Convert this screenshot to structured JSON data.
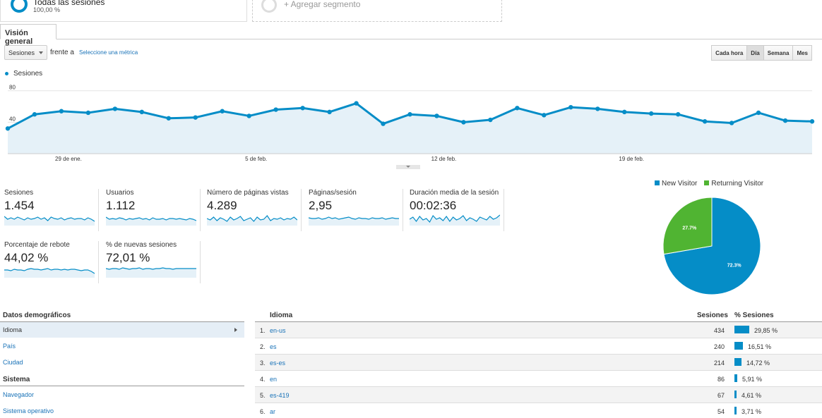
{
  "segments": {
    "active_name": "Todas las sesiones",
    "active_pct": "100,00 %",
    "add_label": "+ Agregar segmento"
  },
  "tab": "Visión general",
  "controls": {
    "metric": "Sesiones",
    "vs": "frente a",
    "pick_metric": "Seleccione una métrica",
    "granularity": [
      "Cada hora",
      "Día",
      "Semana",
      "Mes"
    ],
    "active_granularity": "Día"
  },
  "chart_data": {
    "type": "area",
    "series": [
      {
        "name": "Sesiones",
        "values": [
          32,
          50,
          54,
          52,
          57,
          53,
          45,
          46,
          54,
          48,
          56,
          58,
          53,
          64,
          38,
          50,
          48,
          40,
          43,
          58,
          49,
          59,
          57,
          53,
          51,
          50,
          41,
          39,
          52,
          42,
          41
        ]
      }
    ],
    "y_ticks": [
      "80",
      "40"
    ],
    "ylim": [
      0,
      95
    ],
    "x_ticks": [
      "29 de ene.",
      "5 de feb.",
      "12 de feb.",
      "19 de feb."
    ],
    "color": "#058dc7"
  },
  "scorecards": [
    {
      "label": "Sesiones",
      "value": "1.454"
    },
    {
      "label": "Usuarios",
      "value": "1.112"
    },
    {
      "label": "Número de páginas vistas",
      "value": "4.289"
    },
    {
      "label": "Páginas/sesión",
      "value": "2,95"
    },
    {
      "label": "Duración media de la sesión",
      "value": "00:02:36"
    },
    {
      "label": "Porcentaje de rebote",
      "value": "44,02 %"
    },
    {
      "label": "% de nuevas sesiones",
      "value": "72,01 %"
    }
  ],
  "pie": {
    "type": "pie",
    "series": [
      {
        "name": "New Visitor",
        "value": 72.3,
        "label": "72.3%",
        "color": "#058dc7"
      },
      {
        "name": "Returning Visitor",
        "value": 27.7,
        "label": "27.7%",
        "color": "#50b432"
      }
    ]
  },
  "left_panel": {
    "demo_header": "Datos demográficos",
    "demo_items": [
      "Idioma",
      "País",
      "Ciudad"
    ],
    "system_header": "Sistema",
    "system_items": [
      "Navegador",
      "Sistema operativo"
    ]
  },
  "table": {
    "headers": [
      "Idioma",
      "Sesiones",
      "% Sesiones"
    ],
    "rows": [
      {
        "n": "1.",
        "name": "en-us",
        "sessions": "434",
        "pct": "29,85 %",
        "share": 29.85
      },
      {
        "n": "2.",
        "name": "es",
        "sessions": "240",
        "pct": "16,51 %",
        "share": 16.51
      },
      {
        "n": "3.",
        "name": "es-es",
        "sessions": "214",
        "pct": "14,72 %",
        "share": 14.72
      },
      {
        "n": "4.",
        "name": "en",
        "sessions": "86",
        "pct": "5,91 %",
        "share": 5.91
      },
      {
        "n": "5.",
        "name": "es-419",
        "sessions": "67",
        "pct": "4,61 %",
        "share": 4.61
      },
      {
        "n": "6.",
        "name": "ar",
        "sessions": "54",
        "pct": "3,71 %",
        "share": 3.71
      }
    ]
  }
}
